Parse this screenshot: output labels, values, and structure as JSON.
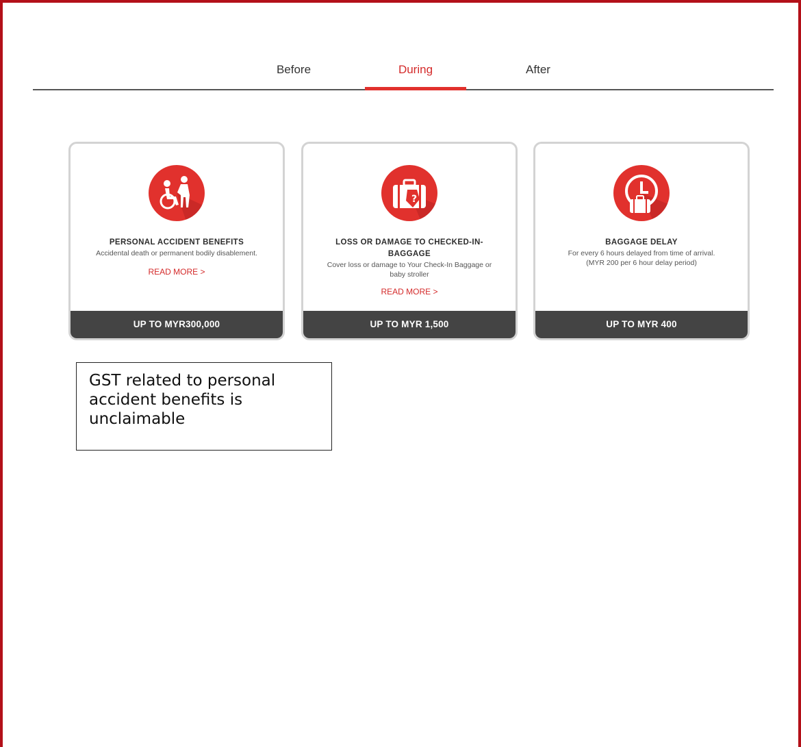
{
  "tabs": [
    {
      "label": "Before",
      "active": false
    },
    {
      "label": "During",
      "active": true
    },
    {
      "label": "After",
      "active": false
    }
  ],
  "colors": {
    "accent": "#e1312d",
    "footer": "#444444",
    "frame": "#b31019"
  },
  "cards": [
    {
      "icon": "wheelchair-assist-icon",
      "title": "PERSONAL ACCIDENT BENEFITS",
      "description": "Accidental death or permanent bodily disablement.",
      "read_more": "READ MORE >",
      "footer": "UP TO MYR300,000"
    },
    {
      "icon": "lost-luggage-icon",
      "title_line1": "LOSS OR DAMAGE TO CHECKED-IN-",
      "title_line2": "BAGGAGE",
      "description_line1": "Cover loss or damage to Your Check-In Baggage or",
      "description_line2": "baby stroller",
      "read_more": "READ MORE >",
      "footer": "UP TO MYR 1,500"
    },
    {
      "icon": "clock-luggage-icon",
      "title": "BAGGAGE DELAY",
      "description_line1": "For every 6 hours delayed from time of arrival.",
      "description_line2": "(MYR 200 per 6 hour delay period)",
      "footer": "UP TO MYR 400"
    }
  ],
  "note": {
    "line1": "GST related to personal",
    "line2": "accident benefits is",
    "line3": "unclaimable"
  }
}
